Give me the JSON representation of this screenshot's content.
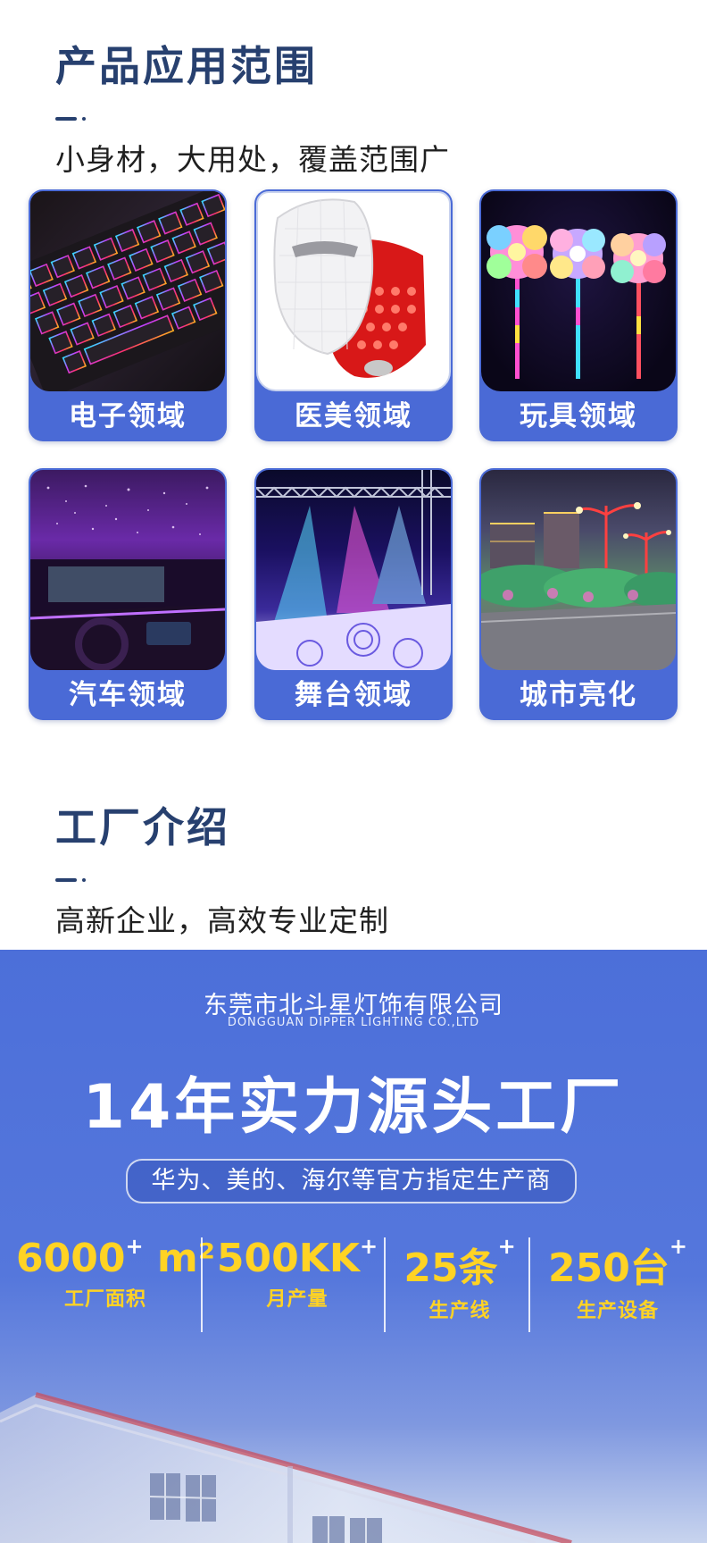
{
  "applications": {
    "title": "产品应用范围",
    "subtitle": "小身材，大用处，覆盖范围广",
    "cards": [
      {
        "label": "电子领域"
      },
      {
        "label": "医美领域"
      },
      {
        "label": "玩具领域"
      },
      {
        "label": "汽车领域"
      },
      {
        "label": "舞台领域"
      },
      {
        "label": "城市亮化"
      }
    ]
  },
  "factory": {
    "title": "工厂介绍",
    "subtitle": "高新企业，高效专业定制",
    "company_cn": "东莞市北斗星灯饰有限公司",
    "company_en": "DONGGUAN DIPPER LIGHTING CO.,LTD",
    "headline": "14年实力源头工厂",
    "pill": "华为、美的、海尔等官方指定生产商",
    "stats": [
      {
        "value": "6000",
        "plus": "+",
        "unit": "m²",
        "caption": "工厂面积"
      },
      {
        "value": "500KK",
        "plus": "+",
        "unit": "",
        "caption": "月产量"
      },
      {
        "value": "25条",
        "plus": "+",
        "unit": "",
        "caption": "生产线"
      },
      {
        "value": "250台",
        "plus": "+",
        "unit": "",
        "caption": "生产设备"
      }
    ]
  },
  "colors": {
    "title_navy": "#27406f",
    "card_blue": "#4a6ad6",
    "panel_blue": "#4c6fd9",
    "stat_yellow": "#ffd324"
  }
}
